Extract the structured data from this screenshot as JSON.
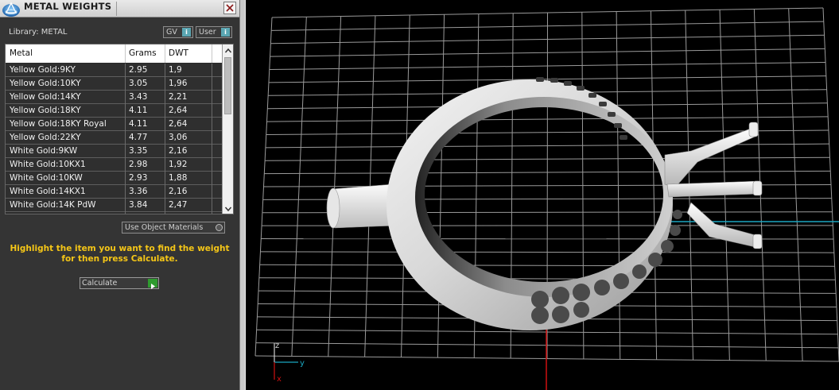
{
  "panel": {
    "title": "METAL WEIGHTS",
    "library_label": "Library: METAL",
    "toggles": {
      "gv": "GV",
      "user": "User",
      "info_glyph": "i"
    },
    "use_object_materials": "Use Object Materials",
    "instruction": "Highlight the item you want to find the weight for then press Calculate.",
    "calculate_label": "Calculate"
  },
  "table": {
    "headers": [
      "Metal",
      "Grams",
      "DWT"
    ],
    "rows": [
      [
        "Yellow Gold:9KY",
        "2.95",
        "1,9"
      ],
      [
        "Yellow Gold:10KY",
        "3.05",
        "1,96"
      ],
      [
        "Yellow Gold:14KY",
        "3.43",
        "2,21"
      ],
      [
        "Yellow Gold:18KY",
        "4.11",
        "2,64"
      ],
      [
        "Yellow Gold:18KY Royal",
        "4.11",
        "2,64"
      ],
      [
        "Yellow Gold:22KY",
        "4.77",
        "3,06"
      ],
      [
        "White Gold:9KW",
        "3.35",
        "2,16"
      ],
      [
        "White Gold:10KX1",
        "2.98",
        "1,92"
      ],
      [
        "White Gold:10KW",
        "2.93",
        "1,88"
      ],
      [
        "White Gold:14KX1",
        "3.36",
        "2,16"
      ],
      [
        "White Gold:14K PdW",
        "3.84",
        "2,47"
      ]
    ]
  },
  "viewport": {
    "axes": {
      "z": "z",
      "y": "y",
      "x": "x"
    },
    "colors": {
      "grid": "#9a9a9a",
      "x_axis": "#d01010",
      "y_axis": "#1aa6c0",
      "z_axis": "#d0d0d0",
      "background": "#000000"
    }
  },
  "icons": {
    "logo": "app-logo-icon",
    "close": "close-icon",
    "scroll_up": "chevron-up-icon",
    "scroll_down": "chevron-down-icon",
    "play": "play-icon"
  }
}
